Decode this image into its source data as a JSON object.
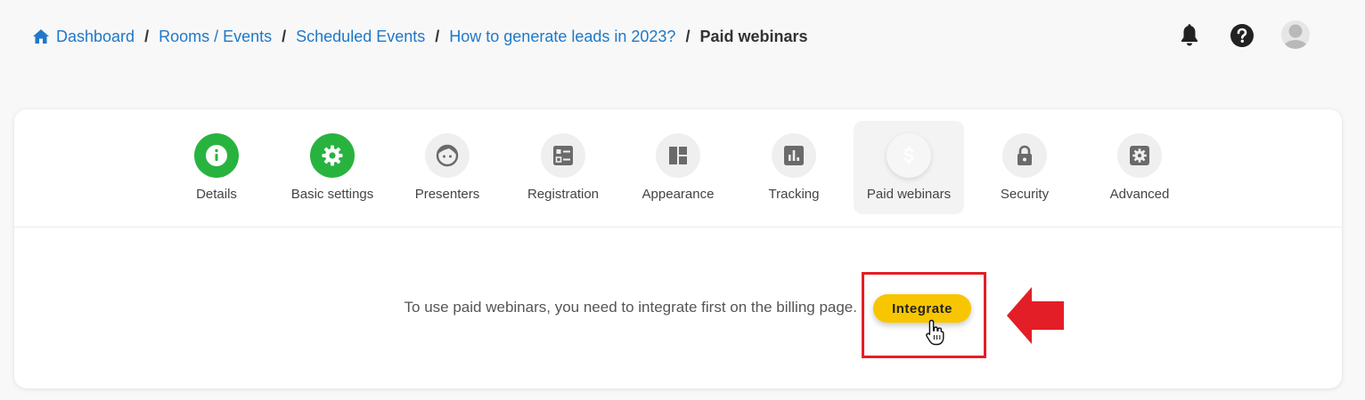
{
  "breadcrumb": {
    "home_icon": "home-icon",
    "separator": "/",
    "items": [
      {
        "label": "Dashboard"
      },
      {
        "label": "Rooms / Events"
      },
      {
        "label": "Scheduled Events"
      },
      {
        "label": "How to generate leads in 2023?"
      }
    ],
    "current": "Paid webinars"
  },
  "header": {
    "icons": [
      "bell-icon",
      "help-icon",
      "avatar"
    ]
  },
  "tabs": [
    {
      "label": "Details",
      "icon": "info-icon",
      "state": "done"
    },
    {
      "label": "Basic settings",
      "icon": "gear-icon",
      "state": "done"
    },
    {
      "label": "Presenters",
      "icon": "face-icon",
      "state": "default"
    },
    {
      "label": "Registration",
      "icon": "form-icon",
      "state": "default"
    },
    {
      "label": "Appearance",
      "icon": "layout-icon",
      "state": "default"
    },
    {
      "label": "Tracking",
      "icon": "chart-icon",
      "state": "default"
    },
    {
      "label": "Paid webinars",
      "icon": "dollar-icon",
      "state": "active"
    },
    {
      "label": "Security",
      "icon": "lock-icon",
      "state": "default"
    },
    {
      "label": "Advanced",
      "icon": "settings-box-icon",
      "state": "default"
    }
  ],
  "body": {
    "message": "To use paid webinars, you need to integrate first on the billing page.",
    "integrate_label": "Integrate"
  },
  "colors": {
    "accent_link": "#1f78c8",
    "done_green": "#28b33f",
    "button_yellow": "#f7c600",
    "annotation_red": "#e41e26"
  }
}
